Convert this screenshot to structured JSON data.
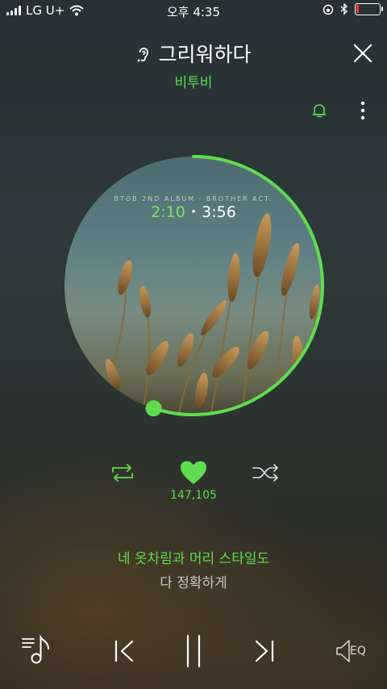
{
  "status_bar": {
    "carrier": "LG U+",
    "time": "오후 4:35"
  },
  "header": {
    "song_title": "그리워하다",
    "artist": "비투비"
  },
  "album": {
    "caption": "BTOB 2ND ALBUM · BROTHER ACT.",
    "current_time": "2:10",
    "separator": "•",
    "total_time": "3:56",
    "progress_fraction": 0.55
  },
  "like": {
    "count": "147,105"
  },
  "lyrics": {
    "current": "네 옷차림과 머리 스타일도",
    "next": "다 정확하게"
  },
  "bottom_bar": {
    "eq_label": "EQ"
  },
  "colors": {
    "accent": "#5fdc4f",
    "battery_low": "#ff3b30"
  }
}
